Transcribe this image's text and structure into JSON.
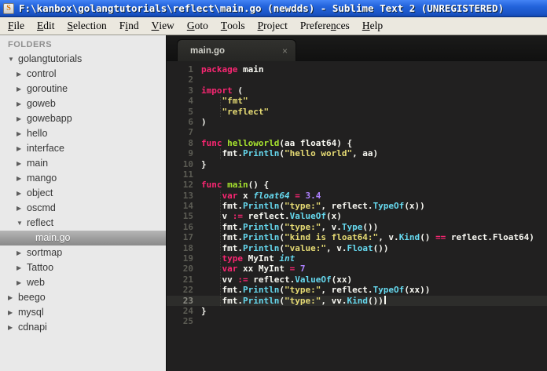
{
  "window": {
    "title": "F:\\kanbox\\golangtutorials\\reflect\\main.go (newdds) - Sublime Text 2 (UNREGISTERED)",
    "icon_letter": "S"
  },
  "menu": {
    "items": [
      {
        "label": "File",
        "mnemonic": 0
      },
      {
        "label": "Edit",
        "mnemonic": 0
      },
      {
        "label": "Selection",
        "mnemonic": 0
      },
      {
        "label": "Find",
        "mnemonic": 1
      },
      {
        "label": "View",
        "mnemonic": 0
      },
      {
        "label": "Goto",
        "mnemonic": 0
      },
      {
        "label": "Tools",
        "mnemonic": 0
      },
      {
        "label": "Project",
        "mnemonic": 0
      },
      {
        "label": "Preferences",
        "mnemonic": 7
      },
      {
        "label": "Help",
        "mnemonic": 0
      }
    ]
  },
  "sidebar": {
    "header": "FOLDERS",
    "icons": {
      "expanded": "▼",
      "collapsed": "▶"
    },
    "tree": [
      {
        "label": "golangtutorials",
        "level": 0,
        "type": "folder",
        "state": "expanded"
      },
      {
        "label": "control",
        "level": 1,
        "type": "folder",
        "state": "collapsed"
      },
      {
        "label": "goroutine",
        "level": 1,
        "type": "folder",
        "state": "collapsed"
      },
      {
        "label": "goweb",
        "level": 1,
        "type": "folder",
        "state": "collapsed"
      },
      {
        "label": "gowebapp",
        "level": 1,
        "type": "folder",
        "state": "collapsed"
      },
      {
        "label": "hello",
        "level": 1,
        "type": "folder",
        "state": "collapsed"
      },
      {
        "label": "interface",
        "level": 1,
        "type": "folder",
        "state": "collapsed"
      },
      {
        "label": "main",
        "level": 1,
        "type": "folder",
        "state": "collapsed"
      },
      {
        "label": "mango",
        "level": 1,
        "type": "folder",
        "state": "collapsed"
      },
      {
        "label": "object",
        "level": 1,
        "type": "folder",
        "state": "collapsed"
      },
      {
        "label": "oscmd",
        "level": 1,
        "type": "folder",
        "state": "collapsed"
      },
      {
        "label": "reflect",
        "level": 1,
        "type": "folder",
        "state": "expanded"
      },
      {
        "label": "main.go",
        "level": 2,
        "type": "file",
        "selected": true
      },
      {
        "label": "sortmap",
        "level": 1,
        "type": "folder",
        "state": "collapsed"
      },
      {
        "label": "Tattoo",
        "level": 1,
        "type": "folder",
        "state": "collapsed"
      },
      {
        "label": "web",
        "level": 1,
        "type": "folder",
        "state": "collapsed"
      },
      {
        "label": "beego",
        "level": 0,
        "type": "folder",
        "state": "collapsed"
      },
      {
        "label": "mysql",
        "level": 0,
        "type": "folder",
        "state": "collapsed"
      },
      {
        "label": "cdnapi",
        "level": 0,
        "type": "folder",
        "state": "collapsed"
      }
    ]
  },
  "editor": {
    "tab": {
      "label": "main.go",
      "close": "×"
    },
    "active_line": 23,
    "colors": {
      "bg": "#212020",
      "kw": "#f92672",
      "op": "#f92672",
      "fn": "#a6e22e",
      "ty": "#66d9ef",
      "mt": "#66d9ef",
      "st": "#e6db74",
      "nu": "#ae81ff",
      "pl": "#f8f8f2",
      "caret": "#f8f8f0"
    },
    "indent_guides": [
      {
        "from": 4,
        "to": 5
      },
      {
        "from": 9,
        "to": 9
      },
      {
        "from": 13,
        "to": 23
      }
    ],
    "lines": [
      [
        [
          "kw",
          "package"
        ],
        [
          "pl",
          " main"
        ]
      ],
      [],
      [
        [
          "kw",
          "import"
        ],
        [
          "pl",
          " ("
        ]
      ],
      [
        [
          "pl",
          "    "
        ],
        [
          "st",
          "\"fmt\""
        ]
      ],
      [
        [
          "pl",
          "    "
        ],
        [
          "st",
          "\"reflect\""
        ]
      ],
      [
        [
          "pl",
          ")"
        ]
      ],
      [],
      [
        [
          "kw",
          "func"
        ],
        [
          "fn",
          " helloworld"
        ],
        [
          "pl",
          "(aa float64) {"
        ]
      ],
      [
        [
          "pl",
          "    fmt."
        ],
        [
          "mt",
          "Println"
        ],
        [
          "pl",
          "("
        ],
        [
          "st",
          "\"hello world\""
        ],
        [
          "pl",
          ", aa)"
        ]
      ],
      [
        [
          "pl",
          "}"
        ]
      ],
      [],
      [
        [
          "kw",
          "func"
        ],
        [
          "fn",
          " main"
        ],
        [
          "pl",
          "() {"
        ]
      ],
      [
        [
          "pl",
          "    "
        ],
        [
          "kw",
          "var"
        ],
        [
          "pl",
          " x "
        ],
        [
          "ty",
          "float64"
        ],
        [
          "pl",
          " "
        ],
        [
          "op",
          "="
        ],
        [
          "pl",
          " "
        ],
        [
          "nu",
          "3.4"
        ]
      ],
      [
        [
          "pl",
          "    fmt."
        ],
        [
          "mt",
          "Println"
        ],
        [
          "pl",
          "("
        ],
        [
          "st",
          "\"type:\""
        ],
        [
          "pl",
          ", reflect."
        ],
        [
          "mt",
          "TypeOf"
        ],
        [
          "pl",
          "(x))"
        ]
      ],
      [
        [
          "pl",
          "    v "
        ],
        [
          "op",
          ":="
        ],
        [
          "pl",
          " reflect."
        ],
        [
          "mt",
          "ValueOf"
        ],
        [
          "pl",
          "(x)"
        ]
      ],
      [
        [
          "pl",
          "    fmt."
        ],
        [
          "mt",
          "Println"
        ],
        [
          "pl",
          "("
        ],
        [
          "st",
          "\"type:\""
        ],
        [
          "pl",
          ", v."
        ],
        [
          "mt",
          "Type"
        ],
        [
          "pl",
          "())"
        ]
      ],
      [
        [
          "pl",
          "    fmt."
        ],
        [
          "mt",
          "Println"
        ],
        [
          "pl",
          "("
        ],
        [
          "st",
          "\"kind is float64:\""
        ],
        [
          "pl",
          ", v."
        ],
        [
          "mt",
          "Kind"
        ],
        [
          "pl",
          "() "
        ],
        [
          "op",
          "=="
        ],
        [
          "pl",
          " reflect.Float64)"
        ]
      ],
      [
        [
          "pl",
          "    fmt."
        ],
        [
          "mt",
          "Println"
        ],
        [
          "pl",
          "("
        ],
        [
          "st",
          "\"value:\""
        ],
        [
          "pl",
          ", v."
        ],
        [
          "mt",
          "Float"
        ],
        [
          "pl",
          "())"
        ]
      ],
      [
        [
          "pl",
          "    "
        ],
        [
          "kw",
          "type"
        ],
        [
          "pl",
          " MyInt "
        ],
        [
          "ty",
          "int"
        ]
      ],
      [
        [
          "pl",
          "    "
        ],
        [
          "kw",
          "var"
        ],
        [
          "pl",
          " xx MyInt "
        ],
        [
          "op",
          "="
        ],
        [
          "pl",
          " "
        ],
        [
          "nu",
          "7"
        ]
      ],
      [
        [
          "pl",
          "    vv "
        ],
        [
          "op",
          ":="
        ],
        [
          "pl",
          " reflect."
        ],
        [
          "mt",
          "ValueOf"
        ],
        [
          "pl",
          "(xx)"
        ]
      ],
      [
        [
          "pl",
          "    fmt."
        ],
        [
          "mt",
          "Println"
        ],
        [
          "pl",
          "("
        ],
        [
          "st",
          "\"type:\""
        ],
        [
          "pl",
          ", reflect."
        ],
        [
          "mt",
          "TypeOf"
        ],
        [
          "pl",
          "(xx))"
        ]
      ],
      [
        [
          "pl",
          "    fmt."
        ],
        [
          "mt",
          "Println"
        ],
        [
          "plu",
          "("
        ],
        [
          "st",
          "\"type:\""
        ],
        [
          "pl",
          ", vv."
        ],
        [
          "mt",
          "Kind"
        ],
        [
          "pl",
          "()"
        ],
        [
          "plu",
          ")"
        ]
      ],
      [
        [
          "pl",
          "}"
        ]
      ],
      []
    ]
  }
}
